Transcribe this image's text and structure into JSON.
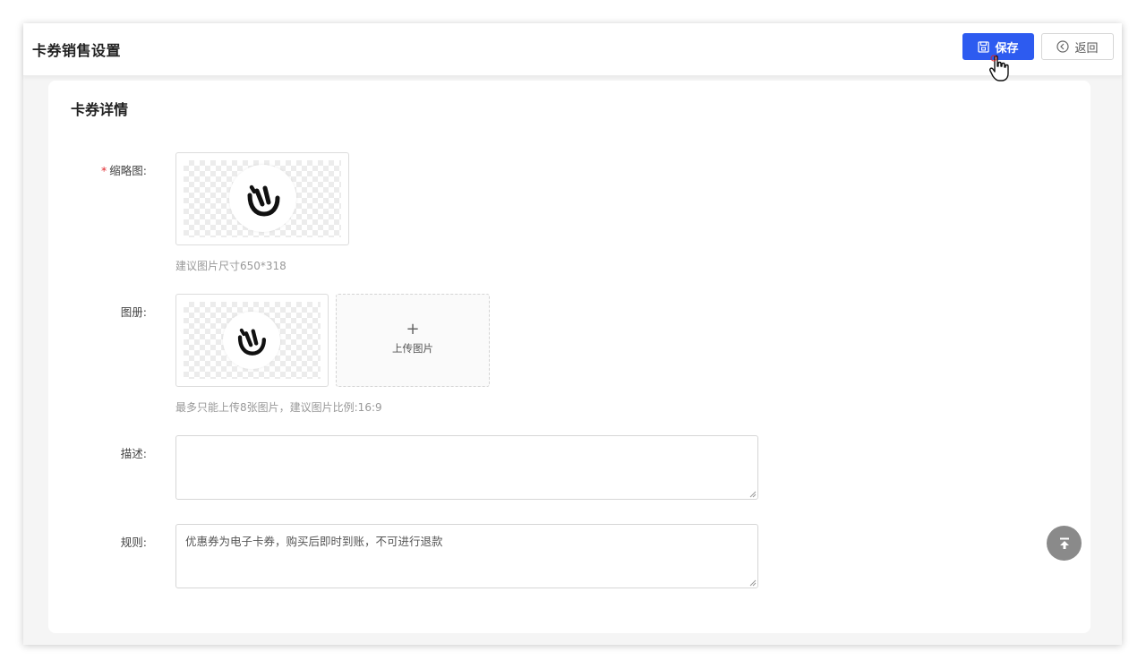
{
  "header": {
    "title": "卡券销售设置",
    "save_label": "保存",
    "back_label": "返回"
  },
  "card": {
    "title": "卡券详情"
  },
  "form": {
    "thumbnail": {
      "required_mark": "*",
      "label": "缩略图:",
      "hint": "建议图片尺寸650*318"
    },
    "album": {
      "label": "图册:",
      "upload_plus": "+",
      "upload_text": "上传图片",
      "hint": "最多只能上传8张图片，建议图片比例:16:9"
    },
    "description": {
      "label": "描述:",
      "value": ""
    },
    "rules": {
      "label": "规则:",
      "value": "优惠券为电子卡券，购买后即时到账，不可进行退款"
    }
  },
  "colors": {
    "primary": "#2d5bf0",
    "required": "#e0282e",
    "back_top": "#8a8a8a"
  },
  "icons": {
    "save": "save-icon",
    "back": "circle-arrow-left-icon",
    "logo": "brand-logo-icon",
    "back_to_top": "arrow-up-to-line-icon",
    "cursor": "hand-pointer-icon"
  }
}
